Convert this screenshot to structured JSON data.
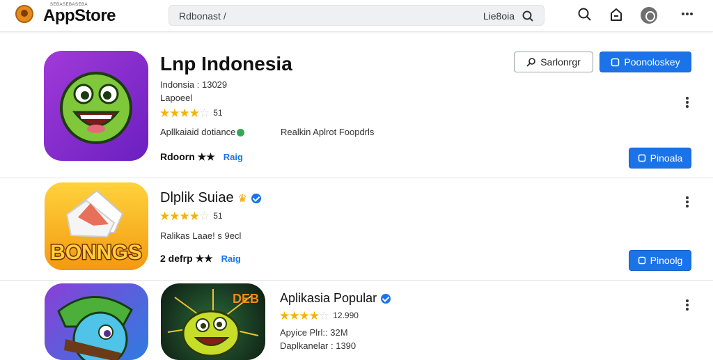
{
  "header": {
    "logo_sub": "SEBASEBASEBA",
    "logo_text": "AppStore",
    "search_text": "Rdbonast  /",
    "search_right": "Lie8oia"
  },
  "featured": {
    "title": "Lnp  Indonesia",
    "line1": "Indonsia : 13029",
    "line2": "Lapoeel",
    "rating_count": "51",
    "category": "Apllkaiaid dotiance",
    "category_right": "Realkin Aplrot Foopdrls",
    "footer_label": "Rdoorn ★★",
    "footer_tag": "Raig",
    "outline_button": "Sarlonrgr",
    "primary_button": "Poonoloskey",
    "secondary_button": "Pinoala"
  },
  "item2": {
    "title": "Dlplik Suiae",
    "rating_count": "51",
    "line1": "Ralikas Laae! s 9ecl",
    "footer_label": "2 defrp ★★",
    "footer_tag": "Raig",
    "button": "Pinoolg",
    "icon_text": "BONNGS"
  },
  "item3": {
    "title": "Aplikasia Popular",
    "rating_count": "12.990",
    "line1": "Apyice Plrl:: 32M",
    "line2": "Daplkanelar : 1390",
    "icon2_text": "DEB"
  }
}
